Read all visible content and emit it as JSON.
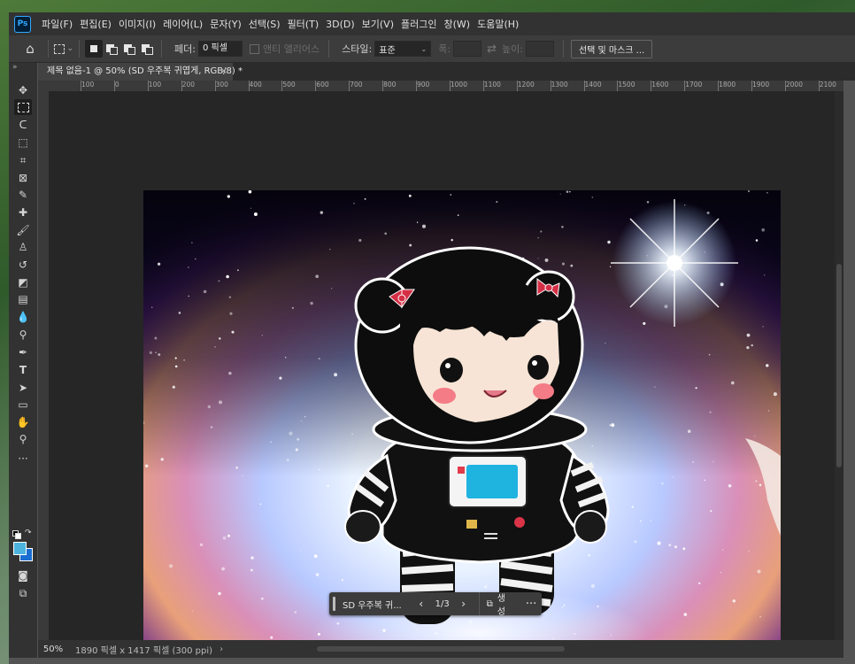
{
  "app": {
    "logo": "Ps"
  },
  "menu": [
    "파일(F)",
    "편집(E)",
    "이미지(I)",
    "레이어(L)",
    "문자(Y)",
    "선택(S)",
    "필터(T)",
    "3D(D)",
    "보기(V)",
    "플러그인",
    "창(W)",
    "도움말(H)"
  ],
  "options": {
    "feather_label": "페더:",
    "feather_value": "0 픽셀",
    "antialias_label": "앤티 앨리어스",
    "style_label": "스타일:",
    "style_value": "표준",
    "width_label": "폭:",
    "height_label": "높이:",
    "select_mask_button": "선택 및 마스크 ..."
  },
  "document": {
    "tab_title": "제목 없음-1 @ 50% (SD 우주복 귀엽게, RGB/8) *",
    "close_glyph": "×"
  },
  "ruler": {
    "labels": [
      "100",
      "0",
      "100",
      "200",
      "300",
      "400",
      "500",
      "600",
      "700",
      "800",
      "900",
      "1000",
      "1100",
      "1200",
      "1300",
      "1400",
      "1500",
      "1600",
      "1700",
      "1800",
      "1900",
      "2000",
      "2100"
    ]
  },
  "status": {
    "zoom": "50%",
    "doc_info": "1890 픽셀 x 1417 픽셀 (300 ppi)",
    "more": "›"
  },
  "generative_bar": {
    "name": "SD 우주복 귀...",
    "prev": "‹",
    "page": "1/3",
    "next": "›",
    "generate_label": "생성",
    "more": "···"
  },
  "colors": {
    "foreground": "#4bb3dd",
    "background": "#1a6ed1",
    "ps_blue": "#31a8ff"
  },
  "tools": [
    "move-tool-icon",
    "marquee-tool-icon",
    "lasso-tool-icon",
    "object-select-tool-icon",
    "crop-tool-icon",
    "frame-tool-icon",
    "eyedropper-tool-icon",
    "healing-brush-tool-icon",
    "brush-tool-icon",
    "clone-stamp-tool-icon",
    "history-brush-tool-icon",
    "eraser-tool-icon",
    "gradient-tool-icon",
    "blur-tool-icon",
    "dodge-tool-icon",
    "pen-tool-icon",
    "type-tool-icon",
    "path-select-tool-icon",
    "rectangle-tool-icon",
    "hand-tool-icon",
    "zoom-tool-icon",
    "more-tools-icon"
  ]
}
